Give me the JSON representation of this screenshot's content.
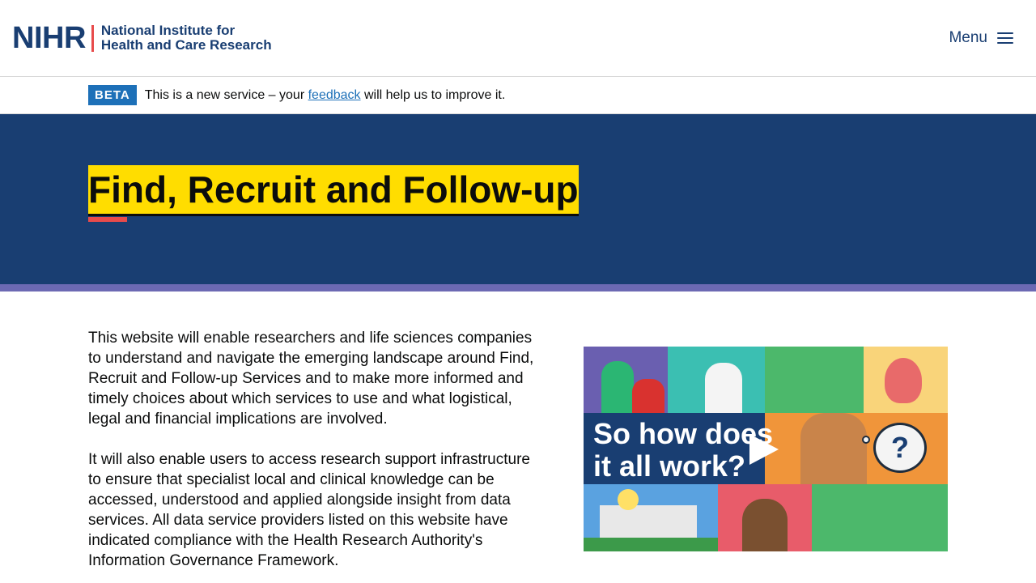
{
  "header": {
    "logo_mark": "NIHR",
    "logo_line1": "National Institute for",
    "logo_line2": "Health and Care Research",
    "menu_label": "Menu",
    "menu_icon": "hamburger-icon"
  },
  "beta": {
    "tag": "BETA",
    "text_before": "This is a new service – your ",
    "link": "feedback",
    "text_after": " will help us to improve it."
  },
  "hero": {
    "title": "Find, Recruit and Follow-up"
  },
  "content": {
    "paragraphs": [
      "This website will enable researchers and life sciences companies to understand and navigate the emerging landscape around Find, Recruit and Follow-up Services and to make more informed and timely choices about which services to use and what logistical, legal and financial implications are involved.",
      "It will also enable users to access research support infrastructure to ensure that specialist local and clinical knowledge can be accessed, understood and applied alongside insight from data services. All data service providers listed on this website have indicated compliance with the Health Research Authority's Information Governance Framework."
    ]
  },
  "video": {
    "caption_line1": "So how does",
    "caption_line2": "it all work?",
    "question_mark": "?",
    "play_icon": "play-icon"
  },
  "colors": {
    "brand_navy": "#193e72",
    "accent_red": "#e84b4b",
    "highlight_yellow": "#ffdd00",
    "stripe_purple": "#6c69b3",
    "link_blue": "#1d70b8"
  }
}
